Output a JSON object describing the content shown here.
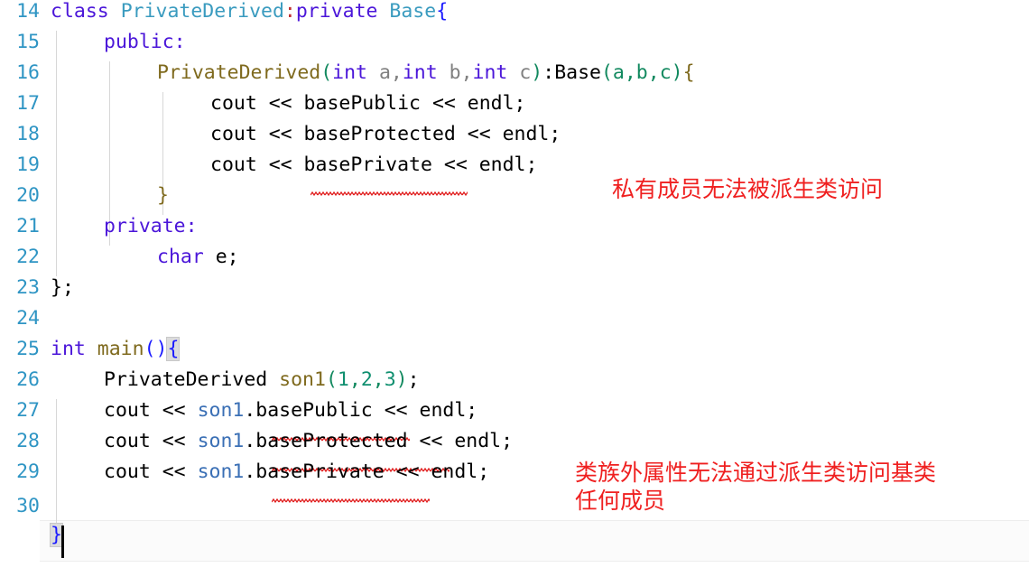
{
  "editor": {
    "language": "cpp",
    "background": "#ffffff",
    "gutter_color": "#2f95c4",
    "current_line_number": "30",
    "annotation_color": "#ef2020"
  },
  "lines": [
    {
      "number": "14",
      "text": "class PrivateDerived:private Base{"
    },
    {
      "number": "15",
      "text": "    public:"
    },
    {
      "number": "16",
      "text": "        PrivateDerived(int a,int b,int c):Base(a,b,c){"
    },
    {
      "number": "17",
      "text": "            cout << basePublic << endl;"
    },
    {
      "number": "18",
      "text": "            cout << baseProtected << endl;"
    },
    {
      "number": "19",
      "text": "            cout << basePrivate << endl;"
    },
    {
      "number": "20",
      "text": "        }"
    },
    {
      "number": "21",
      "text": "    private:"
    },
    {
      "number": "22",
      "text": "        char e;"
    },
    {
      "number": "23",
      "text": "};"
    },
    {
      "number": "24",
      "text": ""
    },
    {
      "number": "25",
      "text": "int main(){"
    },
    {
      "number": "26",
      "text": "    PrivateDerived son1(1,2,3);"
    },
    {
      "number": "27",
      "text": "    cout << son1.basePublic << endl;"
    },
    {
      "number": "28",
      "text": "    cout << son1.baseProtected << endl;"
    },
    {
      "number": "29",
      "text": "    cout << son1.basePrivate << endl;"
    },
    {
      "number": "30",
      "text": "}"
    }
  ],
  "tokens": {
    "l14": {
      "kw_class": "class",
      "type_derived": "PrivateDerived",
      "colon": ":",
      "kw_private": "private",
      "type_base": "Base",
      "brace": "{"
    },
    "l15": {
      "kw_public": "public:"
    },
    "l16": {
      "ctor": "PrivateDerived",
      "lparen": "(",
      "int1": "int",
      "a": " a,",
      "int2": "int",
      "b": " b,",
      "int3": "int",
      "c": " c",
      "rparen": ")",
      "colon": ":",
      "base": "Base",
      "args": "(a,b,c)",
      "brace": "{"
    },
    "l17": {
      "text": "cout << basePublic << endl;"
    },
    "l18": {
      "text": "cout << baseProtected << endl;"
    },
    "l19": {
      "text": "cout << basePrivate << endl;"
    },
    "l20": {
      "brace": "}"
    },
    "l21": {
      "kw_private": "private:"
    },
    "l22": {
      "kw_char": "char",
      "name": " e;"
    },
    "l23": {
      "text": "};"
    },
    "l25": {
      "kw_int": "int",
      "main": " main",
      "parens": "()",
      "brace": "{"
    },
    "l26": {
      "type": "PrivateDerived ",
      "var": "son1",
      "lparen": "(",
      "n1": "1",
      "c1": ",",
      "n2": "2",
      "c2": ",",
      "n3": "3",
      "rparen": ")",
      "semi": ";"
    },
    "l27": {
      "pre": "cout << ",
      "var": "son1",
      "dot": ".",
      "member": "basePublic",
      "post": " << endl;"
    },
    "l28": {
      "pre": "cout << ",
      "var": "son1",
      "dot": ".",
      "member": "baseProtected",
      "post": " << endl;"
    },
    "l29": {
      "pre": "cout << ",
      "var": "son1",
      "dot": ".",
      "member": "basePrivate",
      "post": " << endl;"
    },
    "l30": {
      "brace": "}"
    }
  },
  "annotations": [
    {
      "id": "annot-private-member",
      "text": "私有成员无法被派生类访问"
    },
    {
      "id": "annot-outside-class",
      "line1": "类族外属性无法通过派生类访问基类",
      "line2": "任何成员"
    }
  ],
  "diagnostics": [
    {
      "line": "19",
      "member": "basePrivate"
    },
    {
      "line": "27",
      "member": "basePublic"
    },
    {
      "line": "28",
      "member": "baseProtected"
    },
    {
      "line": "29",
      "member": "basePrivate"
    }
  ]
}
